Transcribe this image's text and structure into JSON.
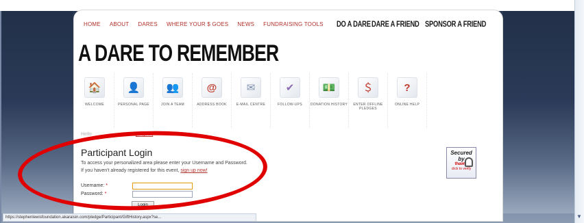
{
  "nav": {
    "links": [
      "HOME",
      "ABOUT",
      "DARES",
      "WHERE YOUR $ GOES",
      "NEWS",
      "FUNDRAISING TOOLS"
    ],
    "big_links": [
      "DO A DARE",
      "DARE A FRIEND",
      "SPONSOR A FRIEND"
    ]
  },
  "site_title": "A DARE TO REMEMBER",
  "toolbar": [
    {
      "label": "WELCOME",
      "icon": "🏠"
    },
    {
      "label": "PERSONAL PAGE",
      "icon": "👤"
    },
    {
      "label": "JOIN A TEAM",
      "icon": "👥"
    },
    {
      "label": "ADDRESS BOOK",
      "icon": "@"
    },
    {
      "label": "E-MAIL CENTRE",
      "icon": "✉"
    },
    {
      "label": "FOLLOW-UPS",
      "icon": "✔"
    },
    {
      "label": "DONATION HISTORY",
      "icon": "💵"
    },
    {
      "label": "ENTER OFFLINE PLEDGES",
      "icon": "＄"
    },
    {
      "label": "ONLINE HELP",
      "icon": "?"
    }
  ],
  "user_line": {
    "greeting": "Hello",
    "logout": "[Logout]"
  },
  "login": {
    "title": "Participant Login",
    "desc1": "To access your personalized area please enter your Username and Password.",
    "desc2_prefix": "If you haven't already registered for this event, ",
    "signup": "sign up now!",
    "username_label": "Username:",
    "password_label": "Password:",
    "required_mark": "*",
    "button": "Login"
  },
  "secured": {
    "line1": "Secured",
    "line2": "by",
    "line3": "thawte",
    "line4": "click to verify"
  },
  "status_url": "https://stephenlewisfoundation.akaraisin.com/pledge/Participant/GiftHistory.aspx?se...",
  "colors": {
    "accent": "#b0302a",
    "annotation": "#e00000"
  }
}
